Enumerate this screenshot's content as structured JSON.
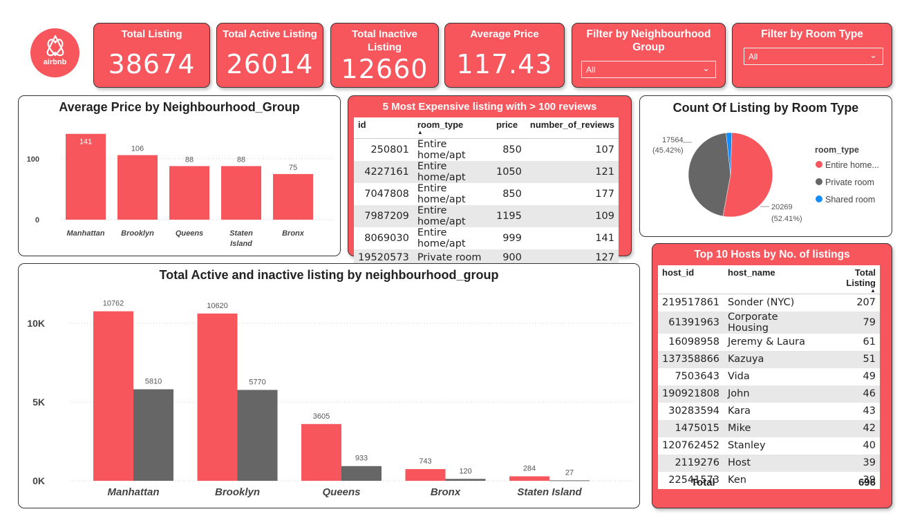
{
  "logo": {
    "text": "airbnb",
    "icon": "airbnb-logo-icon"
  },
  "kpis": [
    {
      "title": "Total Listing",
      "value": "38674"
    },
    {
      "title": "Total Active Listing",
      "value": "26014"
    },
    {
      "title": "Total Inactive Listing",
      "value": "12660"
    },
    {
      "title": "Average Price",
      "value": "117.43"
    }
  ],
  "filters": {
    "neighbourhood": {
      "title": "Filter by Neighbourhood Group",
      "value": "All"
    },
    "room_type": {
      "title": "Filter by Room Type",
      "value": "All"
    }
  },
  "colors": {
    "accent": "#f7565c",
    "gray": "#666666",
    "blue": "#118dff"
  },
  "avg_price_chart": {
    "title": "Average Price by Neighbourhood_Group",
    "chart_data": {
      "type": "bar",
      "categories": [
        "Manhattan",
        "Brooklyn",
        "Queens",
        "Staten Island",
        "Bronx"
      ],
      "category_lines": [
        [
          "Manhattan"
        ],
        [
          "Brooklyn"
        ],
        [
          "Queens"
        ],
        [
          "Staten",
          "Island"
        ],
        [
          "Bronx"
        ]
      ],
      "values": [
        141,
        106,
        88,
        88,
        75
      ],
      "yticks": [
        "0",
        "100"
      ],
      "ylim": [
        0,
        160
      ]
    }
  },
  "expensive_table": {
    "title": "5 Most Expensive listing with > 100 reviews",
    "columns": [
      "id",
      "room_type",
      "price",
      "number_of_reviews"
    ],
    "rows": [
      [
        "250801",
        "Entire home/apt",
        "850",
        "107"
      ],
      [
        "4227161",
        "Entire home/apt",
        "1050",
        "121"
      ],
      [
        "7047808",
        "Entire home/apt",
        "850",
        "177"
      ],
      [
        "7987209",
        "Entire home/apt",
        "1195",
        "109"
      ],
      [
        "8069030",
        "Entire home/apt",
        "999",
        "141"
      ],
      [
        "19520573",
        "Private room",
        "900",
        "127"
      ]
    ]
  },
  "room_type_chart": {
    "title": "Count Of Listing by Room Type",
    "legend_title": "room_type",
    "chart_data": {
      "type": "pie",
      "labels": [
        "Entire home...",
        "Private room",
        "Shared room"
      ],
      "values": [
        20269,
        17564,
        841
      ],
      "colors": [
        "#f7565c",
        "#666666",
        "#118dff"
      ],
      "annotations": [
        {
          "value": "20269",
          "percent": "(52.41%)"
        },
        {
          "value": "17564",
          "percent": "(45.42%)"
        }
      ]
    }
  },
  "hosts_table": {
    "title": "Top 10 Hosts by No. of listings",
    "columns": [
      "host_id",
      "host_name",
      "Total Listing"
    ],
    "rows": [
      [
        "219517861",
        "Sonder (NYC)",
        "207"
      ],
      [
        "61391963",
        "Corporate Housing",
        "79"
      ],
      [
        "16098958",
        "Jeremy & Laura",
        "61"
      ],
      [
        "137358866",
        "Kazuya",
        "51"
      ],
      [
        "7503643",
        "Vida",
        "49"
      ],
      [
        "190921808",
        "John",
        "46"
      ],
      [
        "30283594",
        "Kara",
        "43"
      ],
      [
        "1475015",
        "Mike",
        "42"
      ],
      [
        "120762452",
        "Stanley",
        "40"
      ],
      [
        "2119276",
        "Host",
        "39"
      ],
      [
        "22541573",
        "Ken",
        "39"
      ]
    ],
    "total_label": "Total",
    "total_value": "696"
  },
  "active_chart": {
    "title": "Total Active and inactive listing by neighbourhood_group",
    "chart_data": {
      "type": "bar",
      "categories": [
        "Manhattan",
        "Brooklyn",
        "Queens",
        "Bronx",
        "Staten Island"
      ],
      "series": [
        {
          "values": [
            10762,
            10620,
            3605,
            743,
            284
          ],
          "color": "#f7565c"
        },
        {
          "values": [
            5810,
            5770,
            933,
            120,
            27
          ],
          "color": "#666666"
        }
      ],
      "yticks": [
        "0K",
        "5K",
        "10K"
      ],
      "ylim": [
        0,
        12000
      ]
    }
  }
}
